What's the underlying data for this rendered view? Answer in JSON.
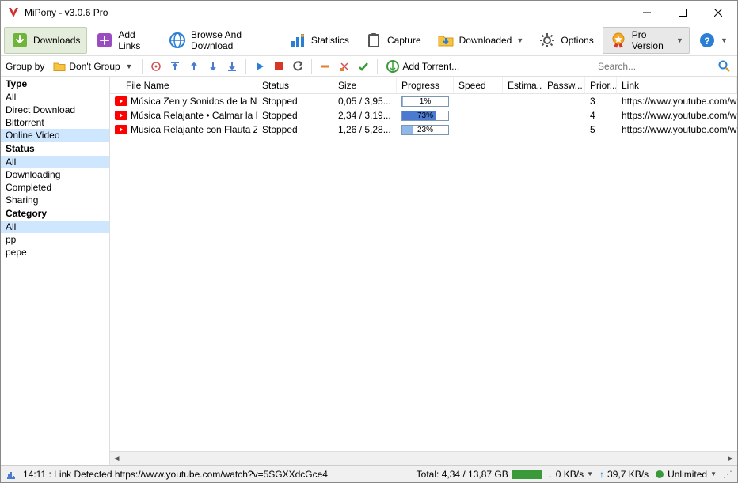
{
  "title": "MiPony - v3.0.6 Pro",
  "toolbar": {
    "downloads": "Downloads",
    "add_links": "Add Links",
    "browse": "Browse And Download",
    "statistics": "Statistics",
    "capture": "Capture",
    "downloaded": "Downloaded",
    "options": "Options",
    "pro": "Pro Version",
    "help": ""
  },
  "secondbar": {
    "group_by": "Group by",
    "group_value": "Don't Group",
    "add_torrent": "Add Torrent...",
    "search_placeholder": "Search..."
  },
  "sidebar": {
    "type": {
      "head": "Type",
      "items": [
        "All",
        "Direct Download",
        "Bittorrent",
        "Online Video"
      ],
      "selected": 3
    },
    "status": {
      "head": "Status",
      "items": [
        "All",
        "Downloading",
        "Completed",
        "Sharing"
      ],
      "selected": 0
    },
    "category": {
      "head": "Category",
      "items": [
        "All",
        "pp",
        "pepe"
      ],
      "selected": 0
    }
  },
  "columns": {
    "name": "File Name",
    "status": "Status",
    "size": "Size",
    "progress": "Progress",
    "speed": "Speed",
    "estimated": "Estima...",
    "password": "Passw...",
    "priority": "Prior...",
    "link": "Link"
  },
  "rows": [
    {
      "name": "Música Zen y Sonidos de la Nat...",
      "status": "Stopped",
      "size": "0,05 / 3,95...",
      "progress": 1,
      "pct": "1%",
      "sel": false,
      "priority": "3",
      "link": "https://www.youtube.com/w"
    },
    {
      "name": "Música Relajante • Calmar la M...",
      "status": "Stopped",
      "size": "2,34 / 3,19...",
      "progress": 73,
      "pct": "73%",
      "sel": true,
      "priority": "4",
      "link": "https://www.youtube.com/w"
    },
    {
      "name": "Musica Relajante con Flauta Ze...",
      "status": "Stopped",
      "size": "1,26 / 5,28...",
      "progress": 23,
      "pct": "23%",
      "sel": false,
      "priority": "5",
      "link": "https://www.youtube.com/w"
    }
  ],
  "statusbar": {
    "log": "14:11 : Link Detected https://www.youtube.com/watch?v=5SGXXdcGce4",
    "total": "Total: 4,34 / 13,87 GB",
    "down": "0 KB/s",
    "up": "39,7 KB/s",
    "unlimited": "Unlimited"
  }
}
